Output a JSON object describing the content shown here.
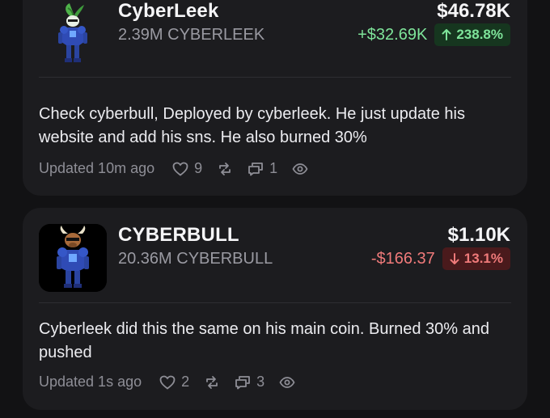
{
  "posts": [
    {
      "token_name": "CyberLeek",
      "holding": "2.39M CYBERLEEK",
      "price": "$46.78K",
      "change_amount": "+$32.69K",
      "change_pct": "238.8%",
      "direction": "up",
      "avatar_icon": "cyberleek-avatar-icon",
      "text": "Check cyberbull, Deployed by cyberleek. He just update his website and add his sns. He also burned 30%",
      "updated": "Updated 10m ago",
      "likes": "9",
      "comments": "1"
    },
    {
      "token_name": "CYBERBULL",
      "holding": "20.36M CYBERBULL",
      "price": "$1.10K",
      "change_amount": "-$166.37",
      "change_pct": "13.1%",
      "direction": "down",
      "avatar_icon": "cyberbull-avatar-icon",
      "text": "Cyberleek did this the same on his main coin. Burned 30% and pushed",
      "updated": "Updated 1s ago",
      "likes": "2",
      "comments": "3"
    }
  ],
  "colors": {
    "background": "#121214",
    "card": "#1c1c1f",
    "up": "#7ee49a",
    "down": "#f07a7a"
  }
}
